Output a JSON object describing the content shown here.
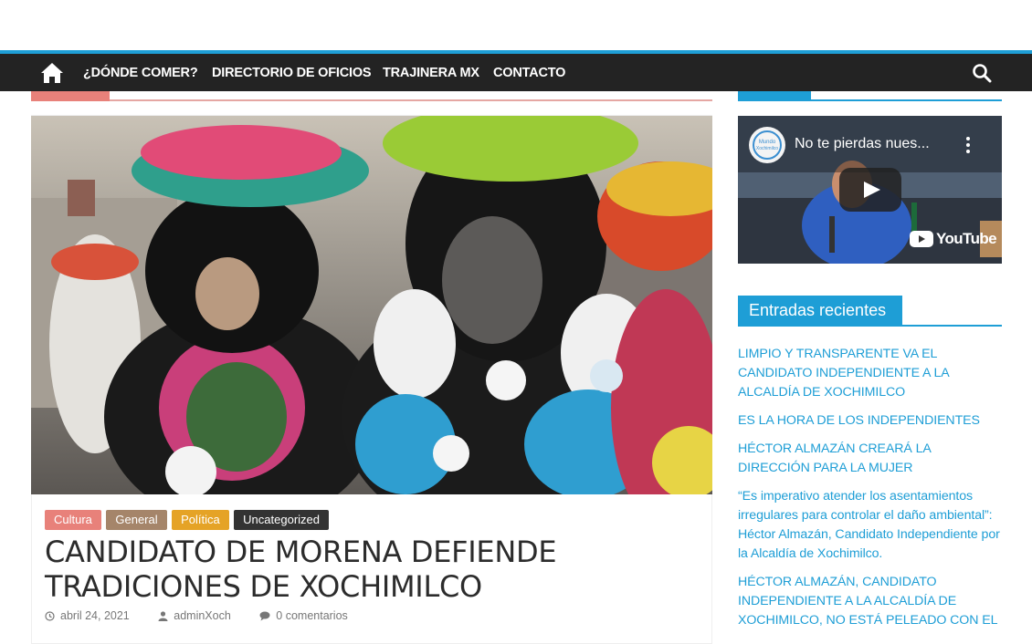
{
  "nav": {
    "home_icon": "home-icon",
    "items": [
      {
        "label": "¿DÓNDE COMER?"
      },
      {
        "label": "DIRECTORIO DE OFICIOS"
      },
      {
        "label": "TRAJINERA MX"
      },
      {
        "label": "CONTACTO"
      }
    ],
    "search_icon": "search-icon",
    "accent_color": "#1e9ed6",
    "bar_color": "#232323"
  },
  "article": {
    "categories": [
      {
        "label": "Cultura",
        "color": "#e8817a"
      },
      {
        "label": "General",
        "color": "#a5856a"
      },
      {
        "label": "Política",
        "color": "#e5a326"
      },
      {
        "label": "Uncategorized",
        "color": "#333333"
      }
    ],
    "title": "CANDIDATO DE MORENA DEFIENDE TRADICIONES DE XOCHIMILCO",
    "date": "abril 24, 2021",
    "author": "adminXoch",
    "comments": "0 comentarios"
  },
  "sidebar": {
    "video": {
      "title": "No te pierdas nues...",
      "logo_text": "Mundo Xochimilco",
      "platform": "YouTube"
    },
    "recent_posts": {
      "heading": "Entradas recientes",
      "items": [
        {
          "label": "LIMPIO Y TRANSPARENTE VA EL CANDIDATO INDEPENDIENTE A LA ALCALDÍA DE XOCHIMILCO"
        },
        {
          "label": "ES LA HORA DE LOS INDEPENDIENTES"
        },
        {
          "label": "HÉCTOR ALMAZÁN CREARÁ LA DIRECCIÓN PARA LA MUJER"
        },
        {
          "label": "“Es imperativo atender los asentamientos irregulares para controlar el daño ambiental”: Héctor Almazán, Candidato Independiente por la Alcaldía de Xochimilco."
        },
        {
          "label": "HÉCTOR ALMAZÁN, CANDIDATO INDEPENDIENTE A LA ALCALDÍA DE XOCHIMILCO, NO ESTÁ PELEADO CON EL"
        }
      ]
    }
  }
}
